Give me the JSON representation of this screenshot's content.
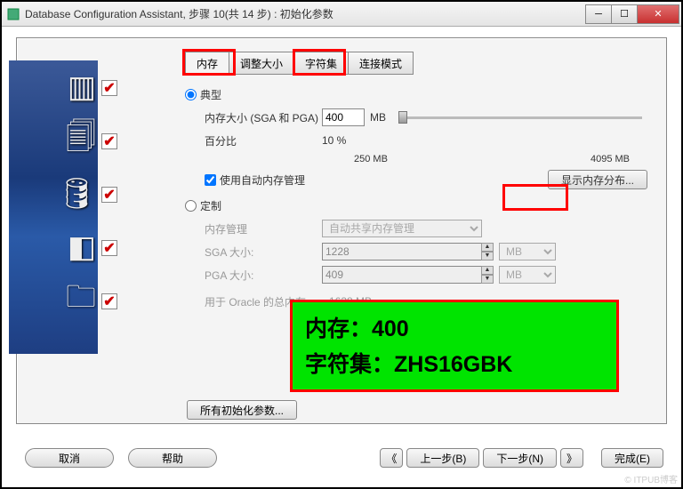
{
  "window": {
    "title": "Database Configuration Assistant, 步骤 10(共 14 步) : 初始化参数"
  },
  "tabs": {
    "memory": "内存",
    "resize": "调整大小",
    "charset": "字符集",
    "connection": "连接模式"
  },
  "radio": {
    "typical": "典型",
    "custom": "定制"
  },
  "fields": {
    "memory_size_label": "内存大小 (SGA 和 PGA)",
    "memory_size_value": "400",
    "memory_size_unit": "MB",
    "percent_label": "百分比",
    "percent_value": "10 %",
    "slider_min": "250 MB",
    "slider_max": "4095 MB",
    "auto_memory_label": "使用自动内存管理",
    "show_dist_button": "显示内存分布...",
    "mem_mgmt_label": "内存管理",
    "mem_mgmt_value": "自动共享内存管理",
    "sga_label": "SGA 大小:",
    "sga_value": "1228",
    "sga_unit": "MB",
    "pga_label": "PGA 大小:",
    "pga_value": "409",
    "pga_unit": "MB",
    "total_label": "用于 Oracle 的总内存:",
    "total_value": "1638 MB"
  },
  "highlight": {
    "line1": "内存：400",
    "line2": "字符集：ZHS16GBK"
  },
  "buttons": {
    "all_params": "所有初始化参数...",
    "cancel": "取消",
    "help": "帮助",
    "prev_small": "《",
    "prev": "上一步(B)",
    "next": "下一步(N)",
    "next_small": "》",
    "finish": "完成(E)"
  },
  "watermark": "© ITPUB博客"
}
